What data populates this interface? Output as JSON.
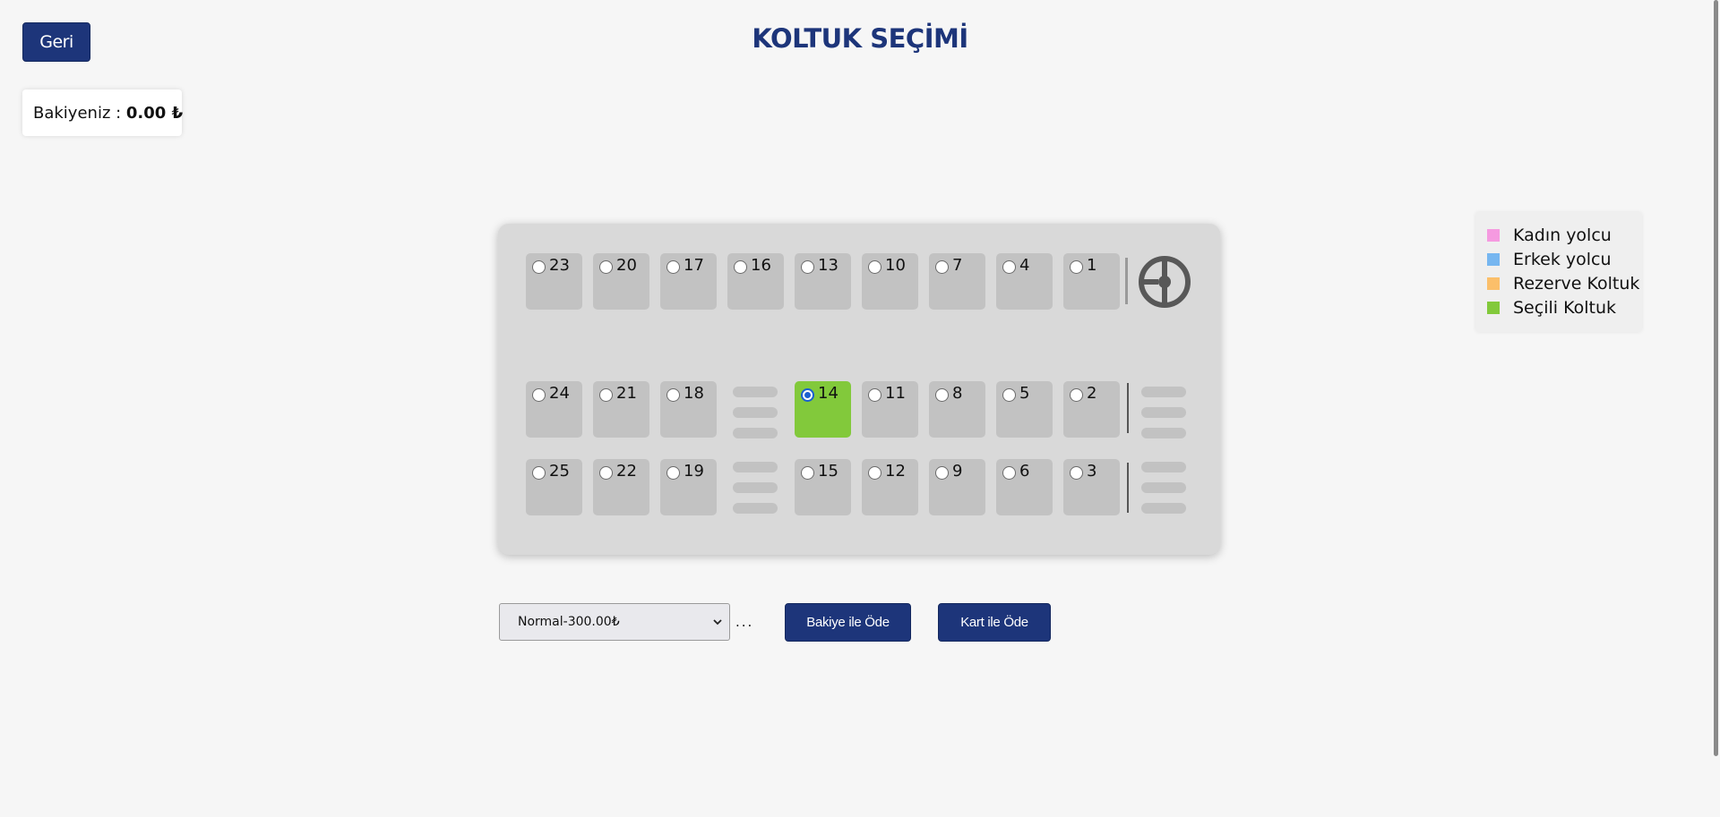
{
  "header": {
    "back_label": "Geri",
    "title": "KOLTUK SEÇİMİ"
  },
  "balance": {
    "label": "Bakiyeniz : ",
    "amount": "0.00 ₺"
  },
  "seats": {
    "row1": [
      "23",
      "20",
      "17",
      "16",
      "13",
      "10",
      "7",
      "4",
      "1"
    ],
    "row2": [
      "24",
      "21",
      "18",
      "",
      "14",
      "11",
      "8",
      "5",
      "2"
    ],
    "row3": [
      "25",
      "22",
      "19",
      "",
      "15",
      "12",
      "9",
      "6",
      "3"
    ],
    "selected": "14"
  },
  "legend": {
    "items": [
      {
        "label": "Kadın yolcu",
        "color": "#f59ae0"
      },
      {
        "label": "Erkek yolcu",
        "color": "#76b6f0"
      },
      {
        "label": "Rezerve Koltuk",
        "color": "#fbbf6a"
      },
      {
        "label": "Seçili Koltuk",
        "color": "#82c93b"
      }
    ]
  },
  "colors": {
    "primary": "#1d357a",
    "seat_empty": "#c2c2c2",
    "seat_selected": "#82c93b"
  },
  "ticket": {
    "selected_option": "Normal-300.00₺",
    "dots": "...",
    "pay_balance_label": "Bakiye ile Öde",
    "pay_card_label": "Kart ile Öde"
  },
  "icons": {
    "steering": "steering-wheel-icon",
    "dropdown": "chevron-down-icon"
  }
}
